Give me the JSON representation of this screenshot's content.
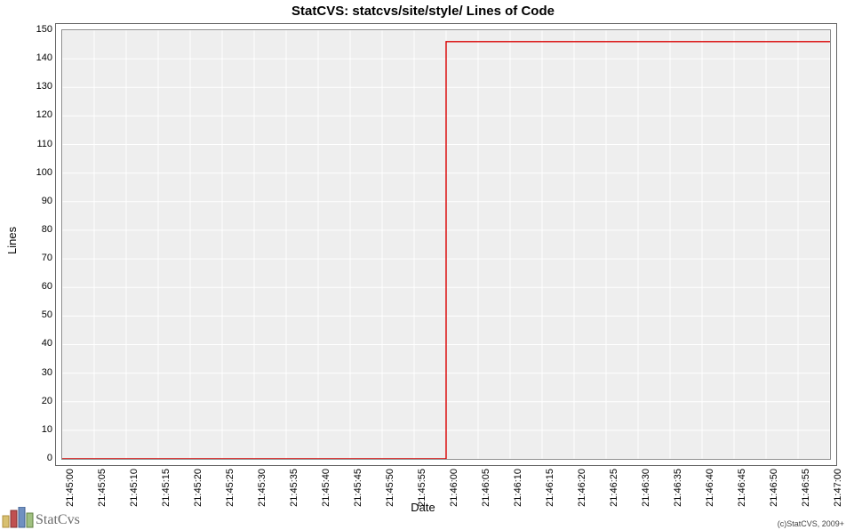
{
  "chart_data": {
    "type": "line",
    "title": "StatCVS: statcvs/site/style/ Lines of Code",
    "xlabel": "Date",
    "ylabel": "Lines",
    "ylim": [
      0,
      150
    ],
    "y_ticks": [
      0,
      10,
      20,
      30,
      40,
      50,
      60,
      70,
      80,
      90,
      100,
      110,
      120,
      130,
      140,
      150
    ],
    "x_ticks": [
      "21:45:00",
      "21:45:05",
      "21:45:10",
      "21:45:15",
      "21:45:20",
      "21:45:25",
      "21:45:30",
      "21:45:35",
      "21:45:40",
      "21:45:45",
      "21:45:50",
      "21:45:55",
      "21:46:00",
      "21:46:05",
      "21:46:10",
      "21:46:15",
      "21:46:20",
      "21:46:25",
      "21:46:30",
      "21:46:35",
      "21:46:40",
      "21:46:45",
      "21:46:50",
      "21:46:55",
      "21:47:00"
    ],
    "x_range_seconds": [
      0,
      120
    ],
    "series": [
      {
        "name": "Lines of Code",
        "points": [
          {
            "x_sec": 0,
            "y": 0
          },
          {
            "x_sec": 60,
            "y": 0
          },
          {
            "x_sec": 60,
            "y": 146
          },
          {
            "x_sec": 120,
            "y": 146
          }
        ]
      }
    ]
  },
  "footer": {
    "brand": "StatCvs",
    "copyright": "(c)StatCVS, 2009+"
  }
}
